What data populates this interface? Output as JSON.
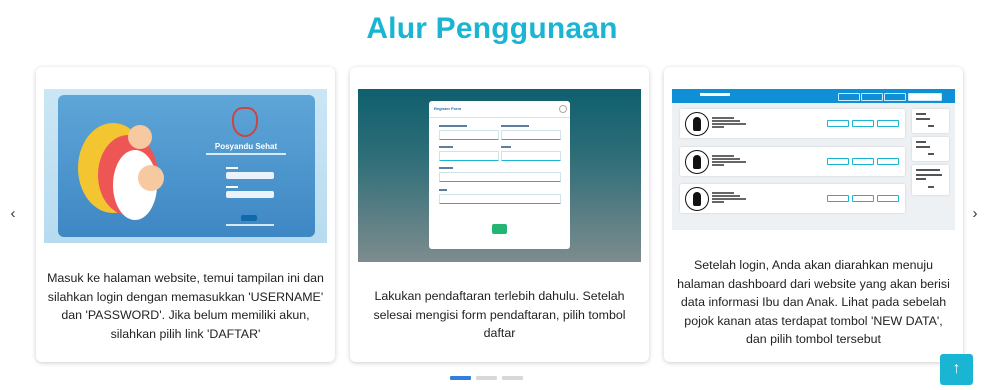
{
  "section": {
    "title": "Alur Penggunaan"
  },
  "carousel": {
    "prev_label": "‹",
    "next_label": "›",
    "cards": [
      {
        "description": "Masuk ke halaman website, temui tampilan ini dan silahkan login dengan memasukkan 'USERNAME' dan 'PASSWORD'. Jika belum memiliki akun, silahkan pilih link 'DAFTAR'",
        "screenshot_title": "Posyandu Sehat"
      },
      {
        "description": "Lakukan pendaftaran terlebih dahulu. Setelah selesai mengisi form pendaftaran, pilih tombol daftar",
        "screenshot_title": "Register Form"
      },
      {
        "description": "Setelah login, Anda akan diarahkan menuju halaman dashboard dari website yang akan berisi data informasi Ibu dan Anak. Lihat pada sebelah pojok kanan atas terdapat tombol 'NEW DATA', dan pilih tombol tersebut",
        "screenshot_title": "Posyandu Sehat"
      }
    ],
    "active_index": 0
  },
  "scroll_top": {
    "label": "↑"
  },
  "colors": {
    "accent": "#19b5d3",
    "dot_active": "#2f7ee0",
    "dot_inactive": "#d8d8d8"
  }
}
